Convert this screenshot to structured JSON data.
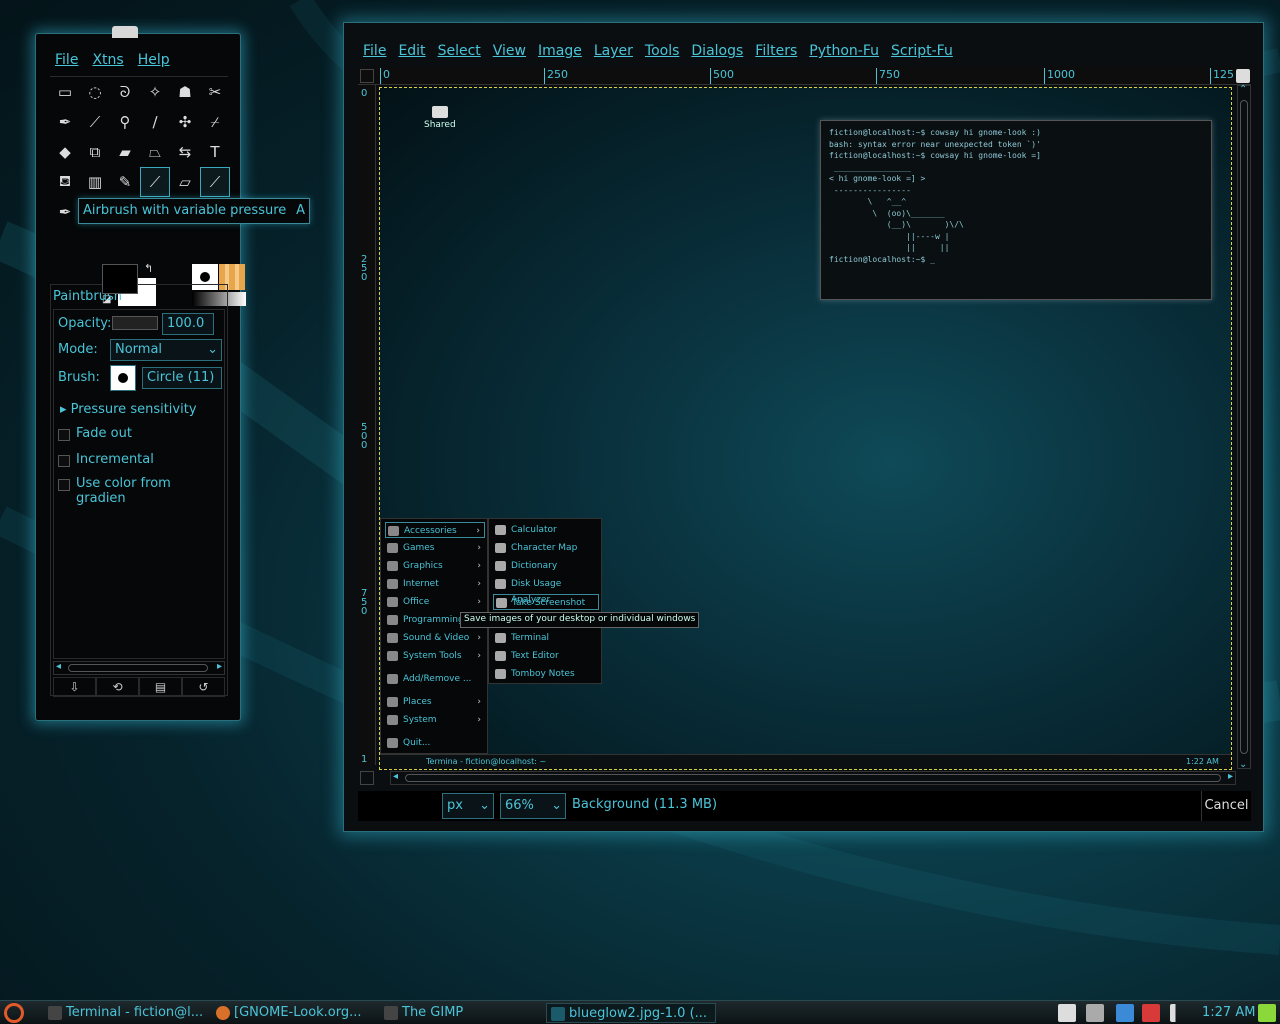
{
  "toolbox": {
    "menu": [
      "File",
      "Xtns",
      "Help"
    ],
    "tooltip": {
      "text": "Airbrush with variable pressure",
      "shortcut": "A"
    },
    "options": {
      "title": "Paintbrush",
      "opacity_label": "Opacity:",
      "opacity_value": "100.0",
      "mode_label": "Mode:",
      "mode_value": "Normal",
      "brush_label": "Brush:",
      "brush_value": "Circle (11)",
      "pressure": "Pressure sensitivity",
      "fade": "Fade out",
      "incremental": "Incremental",
      "gradient": "Use color from gradien"
    }
  },
  "imagewin": {
    "menu": [
      "File",
      "Edit",
      "Select",
      "View",
      "Image",
      "Layer",
      "Tools",
      "Dialogs",
      "Filters",
      "Python-Fu",
      "Script-Fu"
    ],
    "ruler_top": [
      "0",
      "250",
      "500",
      "750",
      "1000",
      "125"
    ],
    "ruler_left": [
      "0",
      "250",
      "500",
      "750",
      "1"
    ],
    "unit": "px",
    "zoom": "66%",
    "status": "Background (11.3 MB)",
    "cancel": "Cancel"
  },
  "canvas": {
    "shared_label": "Shared",
    "terminal_text": "fiction@localhost:~$ cowsay hi gnome-look :)\nbash: syntax error near unexpected token `)'\nfiction@localhost:~$ cowsay hi gnome-look =]\n ________________\n< hi gnome-look =] >\n ----------------\n        \\   ^__^\n         \\  (oo)\\_______\n            (__)\\       )\\/\\\n                ||----w |\n                ||     ||\nfiction@localhost:~$ _",
    "menu1": [
      "Accessories",
      "Games",
      "Graphics",
      "Internet",
      "Office",
      "Programming",
      "Sound & Video",
      "System Tools",
      "Add/Remove ...",
      "Places",
      "System",
      "Quit..."
    ],
    "menu2": [
      "Calculator",
      "Character Map",
      "Dictionary",
      "Disk Usage Analyzer",
      "Take Screenshot",
      "Terminal",
      "Text Editor",
      "Tomboy Notes"
    ],
    "tooltip": "Save images of your desktop or individual windows",
    "mini_task": "Termina - fiction@localhost: ~",
    "mini_clock": "1:22 AM"
  },
  "panel": {
    "tasks": [
      "Terminal - fiction@l...",
      "[GNOME-Look.org...",
      "The GIMP",
      "blueglow2.jpg-1.0 (..."
    ],
    "clock": "1:27 AM"
  },
  "colors": {
    "accent": "#4ac4d8",
    "glow": "#3cc8e6",
    "selection": "#e0d040"
  }
}
